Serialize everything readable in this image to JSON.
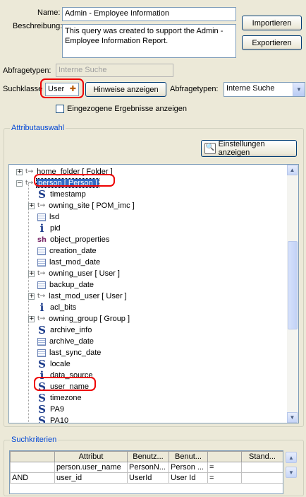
{
  "form": {
    "name_label": "Name:",
    "name_value": "Admin - Employee Information",
    "desc_label": "Beschreibung:",
    "desc_value": "This query was created to support the Admin - Employee Information Report.",
    "import_button": "Importieren",
    "export_button": "Exportieren",
    "abfragetypen_label": "Abfragetypen:",
    "abfragetypen_value": "Interne Suche",
    "suchklasse_label": "Suchklasse",
    "suchklasse_value": "User",
    "hints_button": "Hinweise anzeigen",
    "abfragetypen2_label": "Abfragetypen:",
    "abfragetypen2_value": "Interne Suche",
    "checkbox_label": "Eingezogene Ergebnisse anzeigen"
  },
  "attr": {
    "group_title": "Attributauswahl",
    "settings_button": "Einstellungen anzeigen",
    "tree": [
      {
        "label": "home_folder [ Folder ]",
        "icon": "relation",
        "expander": "+",
        "level": 0
      },
      {
        "label": "person [ Person ]",
        "icon": "relation",
        "expander": "-",
        "level": 0,
        "selected": true
      },
      {
        "label": "timestamp",
        "icon": "string",
        "level": 1
      },
      {
        "label": "owning_site [ POM_imc ]",
        "icon": "relation",
        "expander": "+",
        "level": 1
      },
      {
        "label": "lsd",
        "icon": "date",
        "level": 1
      },
      {
        "label": "pid",
        "icon": "integer",
        "level": 1
      },
      {
        "label": "object_properties",
        "icon": "short",
        "level": 1
      },
      {
        "label": "creation_date",
        "icon": "date",
        "level": 1
      },
      {
        "label": "last_mod_date",
        "icon": "date",
        "level": 1
      },
      {
        "label": "owning_user [ User ]",
        "icon": "relation",
        "expander": "+",
        "level": 1
      },
      {
        "label": "backup_date",
        "icon": "date",
        "level": 1
      },
      {
        "label": "last_mod_user [ User ]",
        "icon": "relation",
        "expander": "+",
        "level": 1
      },
      {
        "label": "acl_bits",
        "icon": "integer",
        "level": 1
      },
      {
        "label": "owning_group [ Group ]",
        "icon": "relation",
        "expander": "+",
        "level": 1
      },
      {
        "label": "archive_info",
        "icon": "string",
        "level": 1
      },
      {
        "label": "archive_date",
        "icon": "date",
        "level": 1
      },
      {
        "label": "last_sync_date",
        "icon": "date",
        "level": 1
      },
      {
        "label": "locale",
        "icon": "string",
        "level": 1
      },
      {
        "label": "data_source",
        "icon": "integer",
        "level": 1
      },
      {
        "label": "user_name",
        "icon": "string",
        "level": 1
      },
      {
        "label": "timezone",
        "icon": "string",
        "level": 1
      },
      {
        "label": "PA9",
        "icon": "string",
        "level": 1
      },
      {
        "label": "PA10",
        "icon": "string",
        "level": 1
      }
    ]
  },
  "criteria": {
    "group_title": "Suchkriterien",
    "columns": [
      "",
      "Attribut",
      "Benutz...",
      "Benut...",
      "",
      "Stand..."
    ],
    "rows": [
      [
        "",
        "person.user_name",
        "PersonN...",
        "Person ...",
        "=",
        ""
      ],
      [
        "AND",
        "user_id",
        "UserId",
        "User Id",
        "=",
        ""
      ]
    ]
  }
}
